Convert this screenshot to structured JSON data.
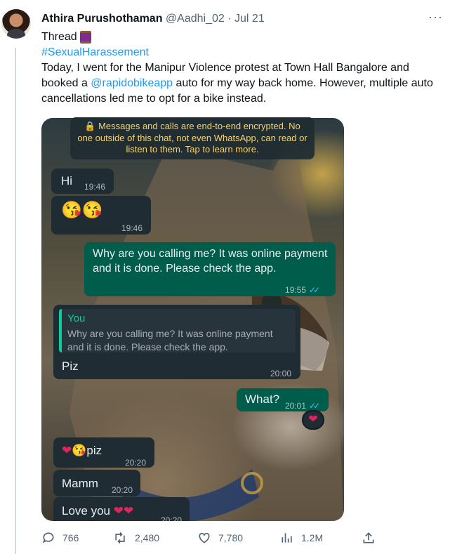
{
  "tweet": {
    "author_name": "Athira Purushothaman",
    "handle": "@Aadhi_02",
    "separator": "·",
    "date": "Jul 21",
    "more_icon": "more-dots-icon",
    "thread_label": "Thread",
    "thread_icon": "spool-of-thread-icon",
    "hashtag": "#SexualHarassement",
    "body_part1": "Today, I went for the Manipur Violence protest at Town Hall Bangalore and booked a ",
    "mention": "@rapidobikeapp",
    "body_part2": " auto for my way back home. However, multiple auto cancellations led me to opt for a bike instead."
  },
  "chat": {
    "system_notice": "🔒 Messages and calls are end-to-end encrypted. No one outside of this chat, not even WhatsApp, can read or listen to them. Tap to learn more.",
    "messages": [
      {
        "text": "Hi",
        "time": "19:46"
      },
      {
        "text": "😘😘",
        "time": "19:46"
      },
      {
        "text": "Why are you calling me? It was online payment and it is done. Please check the app.",
        "time": "19:55",
        "ticks": "✓✓"
      },
      {
        "quote_author": "You",
        "quote_text": "Why are you calling me? It was online payment and it is done. Please check the app.",
        "text": "Piz",
        "time": "20:00"
      },
      {
        "text": "What?",
        "time": "20:01",
        "ticks": "✓✓",
        "reaction": "❤"
      },
      {
        "text_hearts": "❤😘",
        "text": "piz",
        "time": "20:20"
      },
      {
        "text": "Mamm",
        "time": "20:20"
      },
      {
        "text": "Love you ",
        "hearts": "❤❤",
        "time": "20:20"
      }
    ]
  },
  "actions": {
    "replies": "766",
    "retweets": "2,480",
    "likes": "7,780",
    "views": "1.2M",
    "icons": [
      "reply-icon",
      "retweet-icon",
      "like-icon",
      "views-icon",
      "share-icon"
    ]
  },
  "colors": {
    "link": "#1d9bf0",
    "whatsapp_outgoing": "#005c4b",
    "whatsapp_incoming": "#1f2c34",
    "read_ticks": "#53bdeb"
  }
}
